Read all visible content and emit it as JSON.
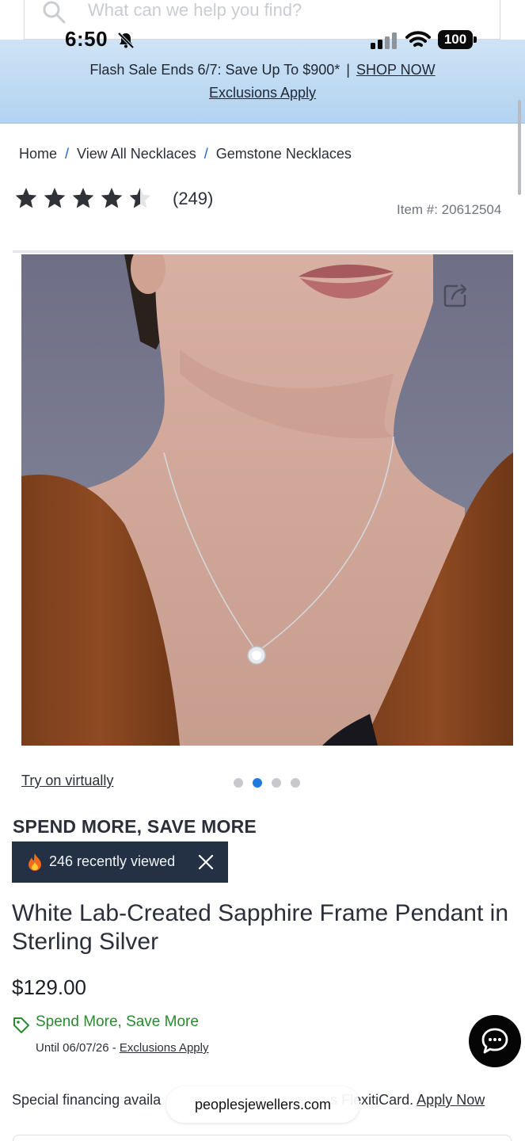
{
  "search": {
    "placeholder": "What can we help you find?"
  },
  "status_bar": {
    "time": "6:50",
    "battery": "100"
  },
  "promo_banner": {
    "text": "Flash Sale Ends 6/7: Save Up To $900*",
    "separator": "|",
    "shop_link": "SHOP NOW",
    "exclusions_link": "Exclusions Apply",
    "background": "#b9d7f2"
  },
  "breadcrumb": {
    "items": [
      "Home",
      "View All Necklaces",
      "Gemstone Necklaces"
    ],
    "separator": "/"
  },
  "rating": {
    "stars": 4.5,
    "max_stars": 5,
    "count_label": "(249)"
  },
  "item_number": "Item #: 20612504",
  "gallery": {
    "try_on_label": "Try on virtually",
    "slides_total": 4,
    "active_slide": 2
  },
  "promo_heading": "SPEND MORE, SAVE MORE",
  "recently_viewed": {
    "text": "246 recently viewed"
  },
  "product": {
    "title": "White Lab-Created Sapphire Frame Pendant in Sterling Silver",
    "price": "$129.00"
  },
  "offer": {
    "label": "Spend More, Save More",
    "until_text": "Until 06/07/26 -",
    "exclusions_link": "Exclusions Apply",
    "color": "#2a8a2e"
  },
  "financing": {
    "text_before": "Special financing availa",
    "text_after": "s FlexitiCard.",
    "apply_link": "Apply Now"
  },
  "browser": {
    "url": "peoplesjewellers.com"
  }
}
